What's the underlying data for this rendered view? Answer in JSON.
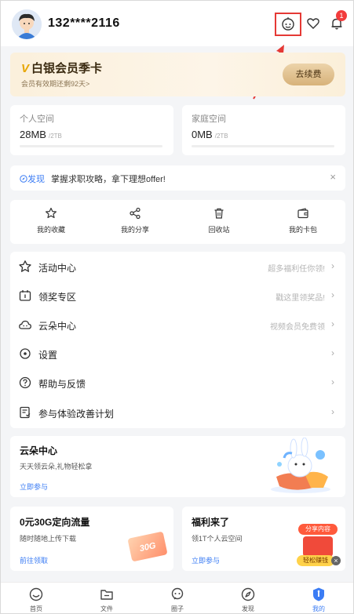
{
  "header": {
    "username": "132****2116",
    "notification_count": "1"
  },
  "vip": {
    "title": "白银会员季卡",
    "subtitle": "会员有效期还剩92天>",
    "renew_label": "去续费"
  },
  "storage": {
    "personal": {
      "label": "个人空间",
      "used": "28MB",
      "total": "/2TB"
    },
    "family": {
      "label": "家庭空间",
      "used": "0MB",
      "total": "/2TB"
    }
  },
  "banner": {
    "tag": "发现",
    "text": "掌握求职攻略，拿下理想offer!",
    "close": "×"
  },
  "quick_actions": [
    {
      "label": "我的收藏",
      "icon": "star-icon"
    },
    {
      "label": "我的分享",
      "icon": "share-icon"
    },
    {
      "label": "回收站",
      "icon": "trash-icon"
    },
    {
      "label": "我的卡包",
      "icon": "wallet-icon"
    }
  ],
  "menu": [
    {
      "label": "活动中心",
      "hint": "超多福利任你领!",
      "icon": "star-icon"
    },
    {
      "label": "领奖专区",
      "hint": "戳这里领奖品!",
      "icon": "prize-icon"
    },
    {
      "label": "云朵中心",
      "hint": "视频会员免费领",
      "icon": "cloud-icon"
    },
    {
      "label": "设置",
      "hint": "",
      "icon": "settings-icon"
    },
    {
      "label": "帮助与反馈",
      "hint": "",
      "icon": "help-icon"
    },
    {
      "label": "参与体验改善计划",
      "hint": "",
      "icon": "survey-icon"
    }
  ],
  "cloud_card": {
    "title": "云朵中心",
    "subtitle": "天天领云朵,礼物轻松拿",
    "link": "立即参与"
  },
  "promos": [
    {
      "title": "0元30G定向流量",
      "subtitle": "随时随地上传下载",
      "link": "前往领取",
      "badge": "30G"
    },
    {
      "title": "福利来了",
      "subtitle": "领1T个人云空间",
      "link": "立即参与",
      "badge_top": "分享内容",
      "badge_bottom": "轻松赚钱"
    }
  ],
  "bottom_nav": [
    {
      "label": "首页",
      "active": false
    },
    {
      "label": "文件",
      "active": false
    },
    {
      "label": "圈子",
      "active": false
    },
    {
      "label": "发现",
      "active": false
    },
    {
      "label": "我的",
      "active": true
    }
  ],
  "colors": {
    "accent": "#3b7cf4",
    "badge": "#f23c3c",
    "highlight_box": "#e53935",
    "vip_gold": "#e7a600"
  }
}
